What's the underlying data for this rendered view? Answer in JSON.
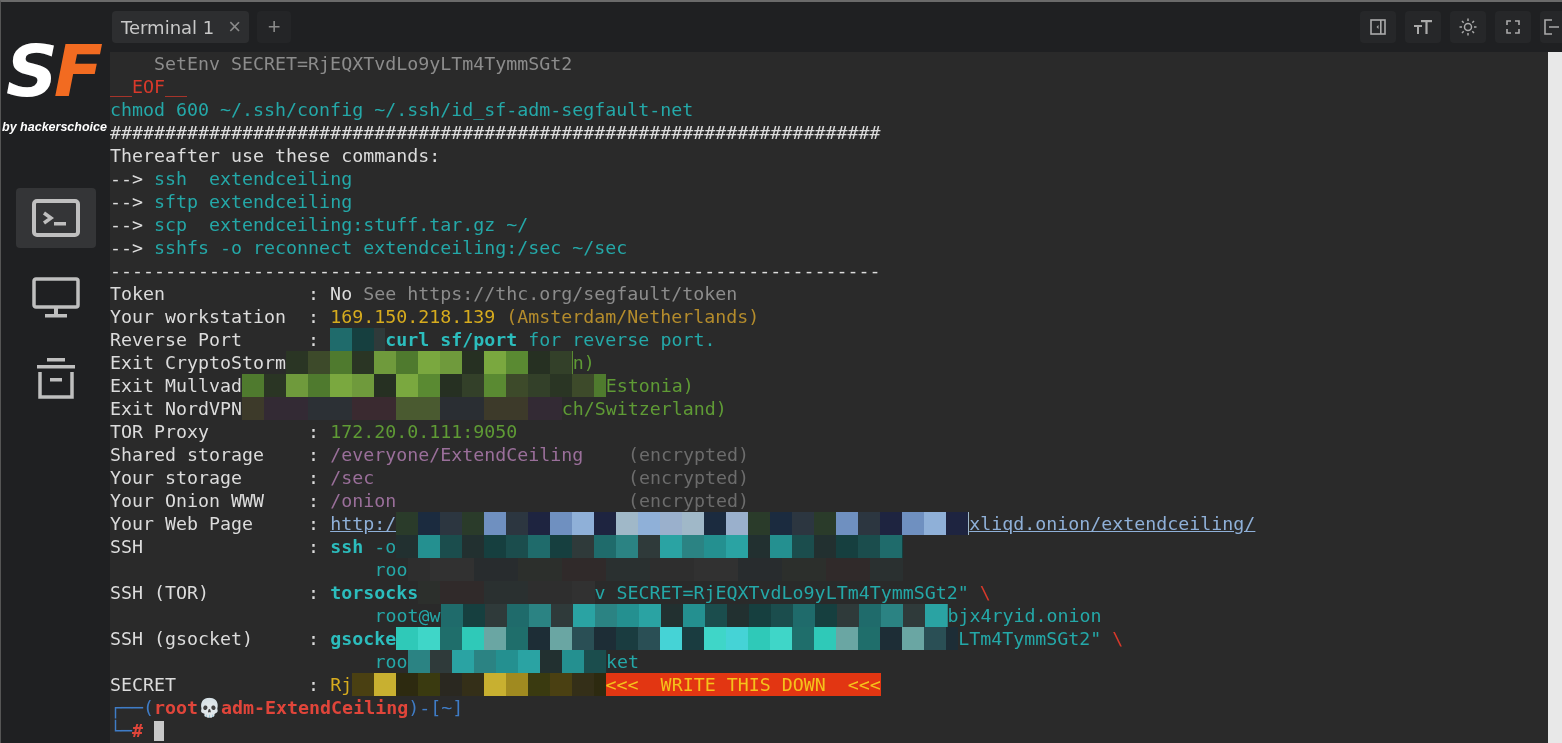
{
  "sidebar": {
    "logo": [
      {
        "text": "S",
        "color": "#ffffff"
      },
      {
        "text": "F",
        "color": "#f26b21"
      }
    ],
    "byline": "by hackerschoice",
    "items": [
      {
        "kind": "terminal",
        "selected": true
      },
      {
        "kind": "monitor",
        "selected": false
      },
      {
        "kind": "archive",
        "selected": false
      }
    ]
  },
  "tabs": [
    {
      "label": "Terminal 1",
      "selected": true,
      "close": "×"
    }
  ],
  "new_tab": "+",
  "terminal": {
    "lines": [
      {
        "segments": [
          {
            "kind": "grey",
            "text": "    SetEnv SECRET=RjEQXTvdLo9yLTm4TymmSGt2"
          }
        ]
      },
      {
        "segments": [
          {
            "kind": "red",
            "text": "__EOF__"
          }
        ]
      },
      {
        "segments": [
          {
            "kind": "teal",
            "text": "chmod 600 ~/.ssh/config ~/.ssh/id_sf-adm-segfault-net"
          }
        ]
      },
      {
        "segments": [
          {
            "kind": "plain",
            "text": "######################################################################"
          }
        ]
      },
      {
        "segments": [
          {
            "kind": "plain",
            "text": "Thereafter use these commands:"
          }
        ]
      },
      {
        "segments": [
          {
            "kind": "plain",
            "text": "--> "
          },
          {
            "kind": "teal",
            "text": "ssh  extendceiling"
          }
        ]
      },
      {
        "segments": [
          {
            "kind": "plain",
            "text": "--> "
          },
          {
            "kind": "teal",
            "text": "sftp extendceiling"
          }
        ]
      },
      {
        "segments": [
          {
            "kind": "plain",
            "text": "--> "
          },
          {
            "kind": "teal",
            "text": "scp  extendceiling:stuff.tar.gz ~/"
          }
        ]
      },
      {
        "segments": [
          {
            "kind": "plain",
            "text": "--> "
          },
          {
            "kind": "teal",
            "text": "sshfs -o reconnect extendceiling:/sec ~/sec"
          }
        ]
      },
      {
        "segments": [
          {
            "kind": "plain",
            "text": "----------------------------------------------------------------------"
          }
        ]
      },
      {
        "segments": [
          {
            "kind": "plain",
            "text": "Token             : No"
          },
          {
            "kind": "grey",
            "text": " See https://thc.org/segfault/token"
          }
        ]
      },
      {
        "segments": [
          {
            "kind": "plain",
            "text": "Your workstation  : "
          },
          {
            "kind": "yellow",
            "text": "169.150.218.139"
          },
          {
            "kind": "darkyellow",
            "text": " (Amsterdam/Netherlands)"
          }
        ]
      },
      {
        "segments": [
          {
            "kind": "plain",
            "text": "Reverse Port      : "
          },
          {
            "kind": "redacted"
          },
          {
            "kind": "bold",
            "text": "curl sf/port"
          },
          {
            "kind": "teal",
            "text": " for reverse port."
          }
        ]
      },
      {
        "segments": [
          {
            "kind": "plain",
            "text": "Exit CryptoStorm"
          },
          {
            "kind": "redacted"
          },
          {
            "kind": "green",
            "text": "n)"
          }
        ]
      },
      {
        "segments": [
          {
            "kind": "plain",
            "text": "Exit Mullvad"
          },
          {
            "kind": "redacted"
          },
          {
            "kind": "green",
            "text": "Estonia)"
          }
        ]
      },
      {
        "segments": [
          {
            "kind": "plain",
            "text": "Exit NordVPN"
          },
          {
            "kind": "redacted"
          },
          {
            "kind": "green",
            "text": "ch/Switzerland)"
          }
        ]
      },
      {
        "segments": [
          {
            "kind": "plain",
            "text": "TOR Proxy         : "
          },
          {
            "kind": "green",
            "text": "172.20.0.111:9050"
          }
        ]
      },
      {
        "segments": [
          {
            "kind": "plain",
            "text": "Shared storage    : "
          },
          {
            "kind": "purple",
            "text": "/everyone/ExtendCeiling"
          },
          {
            "kind": "dim",
            "text": "(encrypted)"
          }
        ]
      },
      {
        "segments": [
          {
            "kind": "plain",
            "text": "Your storage      : "
          },
          {
            "kind": "purple",
            "text": "/sec"
          },
          {
            "kind": "dim",
            "text": "(encrypted)"
          }
        ]
      },
      {
        "segments": [
          {
            "kind": "plain",
            "text": "Your Onion WWW    : "
          },
          {
            "kind": "purple",
            "text": "/onion"
          },
          {
            "kind": "dim",
            "text": "(encrypted)"
          }
        ]
      },
      {
        "segments": [
          {
            "kind": "plain",
            "text": "Your Web Page     : "
          },
          {
            "kind": "link",
            "text": "http:/"
          },
          {
            "kind": "redacted"
          },
          {
            "kind": "link",
            "text": "xliqd.onion/extendceiling/"
          }
        ]
      },
      {
        "segments": [
          {
            "kind": "plain",
            "text": "SSH               : "
          },
          {
            "kind": "bold",
            "text": "ssh"
          },
          {
            "kind": "teal",
            "text": " -o"
          },
          {
            "kind": "redacted"
          }
        ]
      },
      {
        "indent": true,
        "segments": [
          {
            "kind": "teal",
            "text": "roo"
          },
          {
            "kind": "redacted"
          }
        ]
      },
      {
        "segments": [
          {
            "kind": "plain",
            "text": "SSH (TOR)         : "
          },
          {
            "kind": "bold",
            "text": "torsocks"
          },
          {
            "kind": "redacted"
          },
          {
            "kind": "teal",
            "text": "v SECRET=RjEQXTvdLo9yLTm4TymmSGt2\""
          },
          {
            "kind": "red",
            "text": " \\"
          }
        ]
      },
      {
        "indent": true,
        "segments": [
          {
            "kind": "teal",
            "text": "root@w"
          },
          {
            "kind": "redacted"
          },
          {
            "kind": "teal",
            "text": "bjx4ryid.onion"
          }
        ]
      },
      {
        "segments": [
          {
            "kind": "plain",
            "text": "SSH (gsocket)     : "
          },
          {
            "kind": "bold",
            "text": "gsocke"
          },
          {
            "kind": "redacted"
          },
          {
            "kind": "teal",
            "text": "LTm4TymmSGt2\""
          },
          {
            "kind": "red",
            "text": " \\"
          }
        ]
      },
      {
        "indent": true,
        "segments": [
          {
            "kind": "teal",
            "text": "roo"
          },
          {
            "kind": "redacted"
          },
          {
            "kind": "teal",
            "text": "ket"
          }
        ]
      },
      {
        "segments": [
          {
            "kind": "plain",
            "text": "SECRET            : "
          },
          {
            "kind": "yellow",
            "text": "Rj"
          },
          {
            "kind": "redacted"
          },
          {
            "kind": "banner",
            "text": "<<<  WRITE THIS DOWN  <<<"
          }
        ]
      },
      {
        "segments": [
          {
            "kind": "blue",
            "text": "┌──("
          },
          {
            "kind": "redbold",
            "text": "root💀adm-ExtendCeiling"
          },
          {
            "kind": "blue",
            "text": ")-[~]"
          }
        ]
      },
      {
        "segments": [
          {
            "kind": "blue",
            "text": "└─"
          },
          {
            "kind": "redbold",
            "text": "#"
          },
          {
            "kind": "cursor"
          }
        ]
      }
    ]
  }
}
